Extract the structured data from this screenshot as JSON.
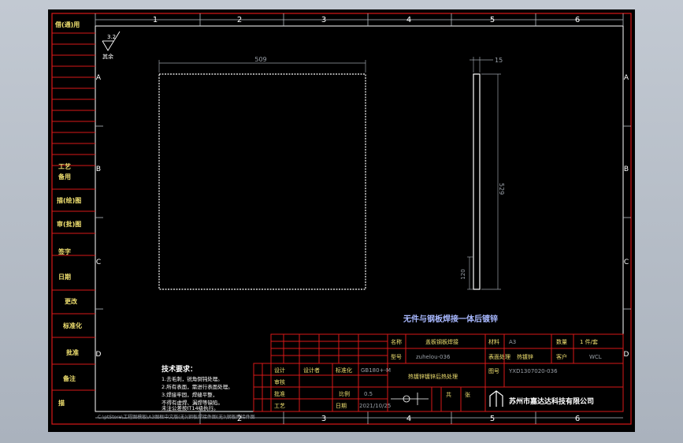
{
  "colors": {
    "background": "#000000",
    "frame_red": "#d81818",
    "frame_white": "#ffffff",
    "ruler_gray": "#b8bec6",
    "text_white": "#ffffff",
    "text_yellow": "#f0e070",
    "dim_gray": "#9aa0a8",
    "title_blue": "#a8b8ff"
  },
  "rulers": {
    "columns": [
      "1",
      "2",
      "3",
      "4",
      "5",
      "6"
    ],
    "rows": [
      "A",
      "B",
      "C",
      "D"
    ]
  },
  "left_strip": {
    "top_label": "借(通)用",
    "labels": [
      "工艺",
      "备用",
      "描(绘)图",
      "审(批)图",
      "签字",
      "日期",
      "更改",
      "标准化",
      "描",
      "图",
      "批准",
      "备注"
    ]
  },
  "roughness": {
    "value": "3.2",
    "note": "其余"
  },
  "dimensions": {
    "width": "509",
    "thickness": "15",
    "height": "529",
    "small": "120"
  },
  "process_note": "无件与钢板焊接一体后镀锌",
  "tech_req": {
    "title": "技术要求：",
    "lines": [
      "1.去毛刺，锐角倒钝处理。",
      "2.所有表面，需进行表面处理。",
      "3.焊接牢固，焊缝平整，",
      "不得有虚焊、漏焊等缺陷。",
      "未注公差按IT14级执行。"
    ]
  },
  "title_block": {
    "name_label": "名称",
    "name_value": "盖板钢板焊接",
    "model_label": "型号",
    "model_value": "zuhelou-036",
    "part_label": "材料",
    "part_value": "A3",
    "weight_label": "数量",
    "weight_value": "1 件/套",
    "process_label": "表面处理",
    "process_value": "热镀锌",
    "customer_label": "客户",
    "customer_value": "WCL",
    "drawing_no_label": "图号",
    "drawing_no_value": "YXD1307020-036",
    "spec_value": "热镀锌镀锌后热处理",
    "std_value": "GB180+-M",
    "scale_label": "比例",
    "scale_value": "0.5",
    "date_value": "2021/10/25",
    "sheet_a": "共",
    "sheet_b": "张",
    "company": "苏州市嘉达达科技有限公司",
    "rows": [
      "设计",
      "审核",
      "工艺",
      "标准化",
      "批准",
      "日期"
    ],
    "row_values": [
      "设计者",
      "",
      "",
      "",
      "",
      ""
    ]
  },
  "path_text": "C:\\ptStore\\工程图模板\\A3图框中文版(无)\\钢板焊接件图(无)\\钢板焊接件图"
}
